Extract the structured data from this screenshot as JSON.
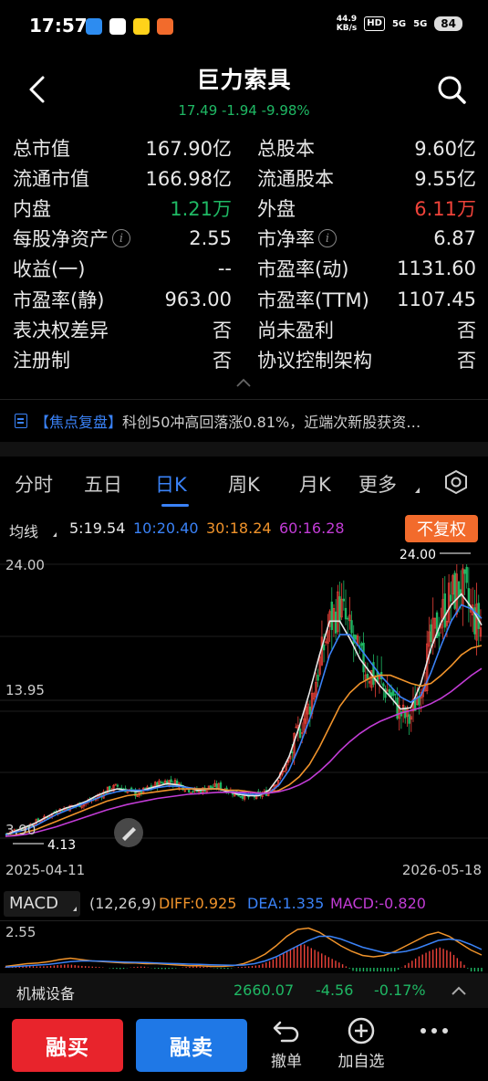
{
  "status_bar": {
    "time": "17:57",
    "net_speed_value": "44.9",
    "net_speed_unit": "KB/s",
    "hd": "HD",
    "sig1": "5G",
    "sig2": "5G",
    "battery": "84"
  },
  "header": {
    "title": "巨力索具",
    "quote": "17.49 -1.94 -9.98%"
  },
  "stats": [
    [
      {
        "label": "总市值",
        "value": "167.90亿"
      },
      {
        "label": "总股本",
        "value": "9.60亿"
      }
    ],
    [
      {
        "label": "流通市值",
        "value": "166.98亿"
      },
      {
        "label": "流通股本",
        "value": "9.55亿"
      }
    ],
    [
      {
        "label": "内盘",
        "value": "1.21万",
        "color": "green"
      },
      {
        "label": "外盘",
        "value": "6.11万",
        "color": "red"
      }
    ],
    [
      {
        "label": "每股净资产",
        "value": "2.55",
        "info": true
      },
      {
        "label": "市净率",
        "value": "6.87",
        "info": true
      }
    ],
    [
      {
        "label": "收益(一)",
        "value": "--"
      },
      {
        "label": "市盈率(动)",
        "value": "1131.60"
      }
    ],
    [
      {
        "label": "市盈率(静)",
        "value": "963.00"
      },
      {
        "label": "市盈率(TTM)",
        "value": "1107.45"
      }
    ],
    [
      {
        "label": "表决权差异",
        "value": "否"
      },
      {
        "label": "尚未盈利",
        "value": "否"
      }
    ],
    [
      {
        "label": "注册制",
        "value": "否"
      },
      {
        "label": "协议控制架构",
        "value": "否"
      }
    ]
  ],
  "news": {
    "tag": "【焦点复盘】",
    "text": "科创50冲高回落涨0.81%，近端次新股获资…"
  },
  "tabs": [
    "分时",
    "五日",
    "日K",
    "周K",
    "月K",
    "更多"
  ],
  "active_tab": "日K",
  "ma": {
    "label": "均线",
    "items": [
      {
        "text": "5:19.54",
        "color": "#e8e8e8"
      },
      {
        "text": "10:20.40",
        "color": "#3a82f7"
      },
      {
        "text": "30:18.24",
        "color": "#f0932b"
      },
      {
        "text": "60:16.28",
        "color": "#c23cd6"
      }
    ],
    "adjust_button": "不复权"
  },
  "chart_data": {
    "type": "candlestick",
    "period": "daily",
    "y_ticks": [
      "24.00",
      "13.95",
      "3.90"
    ],
    "max_label": "24.00",
    "min_label": "4.13",
    "x_start": "2025-04-11",
    "x_end": "2026-05-18",
    "ylim": [
      3.9,
      24.0
    ],
    "close_trend": [
      4.1,
      4.4,
      4.6,
      5.0,
      5.3,
      5.8,
      6.0,
      6.2,
      6.4,
      6.8,
      7.3,
      7.6,
      7.3,
      7.0,
      7.4,
      7.8,
      8.0,
      7.8,
      7.4,
      7.2,
      7.5,
      7.6,
      7.3,
      7.0,
      6.8,
      6.9,
      7.2,
      8.2,
      9.5,
      11.8,
      13.5,
      16.5,
      19.5,
      21.0,
      19.0,
      17.0,
      16.0,
      15.2,
      14.5,
      13.0,
      12.5,
      15.0,
      18.0,
      20.0,
      21.5,
      22.5,
      20.5,
      19.3
    ],
    "ma_trend": {
      "MA5": [
        4.0,
        4.3,
        4.6,
        4.9,
        5.3,
        5.7,
        6.0,
        6.2,
        6.5,
        6.9,
        7.2,
        7.4,
        7.3,
        7.2,
        7.4,
        7.6,
        7.8,
        7.7,
        7.5,
        7.3,
        7.4,
        7.4,
        7.2,
        7.0,
        6.9,
        6.9,
        7.3,
        8.3,
        9.8,
        12.0,
        14.5,
        17.3,
        19.8,
        19.8,
        18.5,
        17.0,
        16.0,
        15.0,
        14.2,
        13.3,
        13.4,
        15.2,
        17.8,
        19.7,
        21.0,
        21.8,
        20.8,
        19.5
      ],
      "MA10": [
        4.0,
        4.2,
        4.4,
        4.7,
        5.1,
        5.5,
        5.8,
        6.1,
        6.4,
        6.7,
        7.0,
        7.2,
        7.3,
        7.3,
        7.3,
        7.5,
        7.6,
        7.6,
        7.5,
        7.4,
        7.4,
        7.4,
        7.3,
        7.1,
        7.0,
        7.0,
        7.1,
        7.7,
        8.8,
        10.5,
        12.5,
        14.8,
        17.3,
        18.8,
        18.8,
        17.8,
        16.8,
        15.8,
        15.0,
        14.2,
        13.8,
        14.3,
        16.0,
        18.0,
        19.8,
        21.0,
        20.7,
        20.0
      ],
      "MA30": [
        3.9,
        4.0,
        4.2,
        4.4,
        4.7,
        5.0,
        5.3,
        5.6,
        5.9,
        6.2,
        6.5,
        6.7,
        6.9,
        7.0,
        7.1,
        7.2,
        7.3,
        7.4,
        7.4,
        7.4,
        7.4,
        7.4,
        7.3,
        7.3,
        7.2,
        7.1,
        7.1,
        7.3,
        7.7,
        8.3,
        9.2,
        10.5,
        12.0,
        13.5,
        14.5,
        15.2,
        15.6,
        15.8,
        15.8,
        15.5,
        15.2,
        15.0,
        15.2,
        15.8,
        16.5,
        17.3,
        17.8,
        18.0
      ],
      "MA60": [
        3.9,
        3.95,
        4.05,
        4.2,
        4.4,
        4.6,
        4.85,
        5.1,
        5.35,
        5.6,
        5.85,
        6.05,
        6.25,
        6.4,
        6.55,
        6.7,
        6.8,
        6.9,
        7.0,
        7.05,
        7.1,
        7.15,
        7.15,
        7.15,
        7.15,
        7.1,
        7.1,
        7.2,
        7.4,
        7.7,
        8.1,
        8.7,
        9.4,
        10.2,
        10.9,
        11.5,
        12.0,
        12.4,
        12.7,
        13.0,
        13.2,
        13.4,
        13.7,
        14.1,
        14.6,
        15.2,
        15.8,
        16.3
      ]
    }
  },
  "macd": {
    "label": "MACD",
    "params": "(12,26,9)",
    "diff": "DIFF:0.925",
    "dea": "DEA:1.335",
    "macd_value": "MACD:-0.820",
    "y_tick": "2.55",
    "hist": [
      0.05,
      0.1,
      0.15,
      0.1,
      0.12,
      0.2,
      0.25,
      0.15,
      0.1,
      0.05,
      -0.05,
      -0.1,
      0.05,
      0.1,
      -0.05,
      -0.1,
      -0.05,
      0.05,
      0.1,
      0.05,
      -0.05,
      -0.08,
      0.05,
      0.1,
      0.2,
      0.5,
      0.9,
      1.4,
      1.8,
      1.4,
      1.0,
      0.6,
      0.2,
      -0.3,
      -0.6,
      -0.8,
      -0.5,
      -0.2,
      0.3,
      0.8,
      1.2,
      1.5,
      1.2,
      0.5,
      -0.3,
      -0.82
    ],
    "diff_trend": [
      0.1,
      0.2,
      0.3,
      0.35,
      0.45,
      0.6,
      0.7,
      0.6,
      0.5,
      0.45,
      0.4,
      0.35,
      0.35,
      0.3,
      0.3,
      0.25,
      0.2,
      0.15,
      0.15,
      0.1,
      0.1,
      0.15,
      0.3,
      0.6,
      1.0,
      1.6,
      2.3,
      2.8,
      2.9,
      2.6,
      2.1,
      1.6,
      1.2,
      0.9,
      0.8,
      0.9,
      1.2,
      1.6,
      2.0,
      2.4,
      2.6,
      2.3,
      1.8,
      1.3,
      0.93
    ],
    "dea_trend": [
      0.05,
      0.1,
      0.15,
      0.2,
      0.25,
      0.35,
      0.45,
      0.5,
      0.5,
      0.48,
      0.45,
      0.42,
      0.4,
      0.38,
      0.35,
      0.32,
      0.3,
      0.27,
      0.25,
      0.22,
      0.2,
      0.18,
      0.2,
      0.3,
      0.5,
      0.8,
      1.2,
      1.6,
      2.0,
      2.3,
      2.3,
      2.1,
      1.8,
      1.5,
      1.3,
      1.1,
      1.1,
      1.2,
      1.4,
      1.7,
      2.0,
      2.1,
      2.0,
      1.7,
      1.34
    ]
  },
  "industry": {
    "name": "机械设备",
    "price": "2660.07",
    "change": "-4.56",
    "pct": "-0.17%"
  },
  "bottom_bar": {
    "buy": "融买",
    "sell": "融卖",
    "undo": "撤单",
    "add_watch": "加自选"
  },
  "colors": {
    "up": "#f0433a",
    "down": "#1fb864",
    "accent": "#3a82f7",
    "orange": "#f26b2c"
  }
}
